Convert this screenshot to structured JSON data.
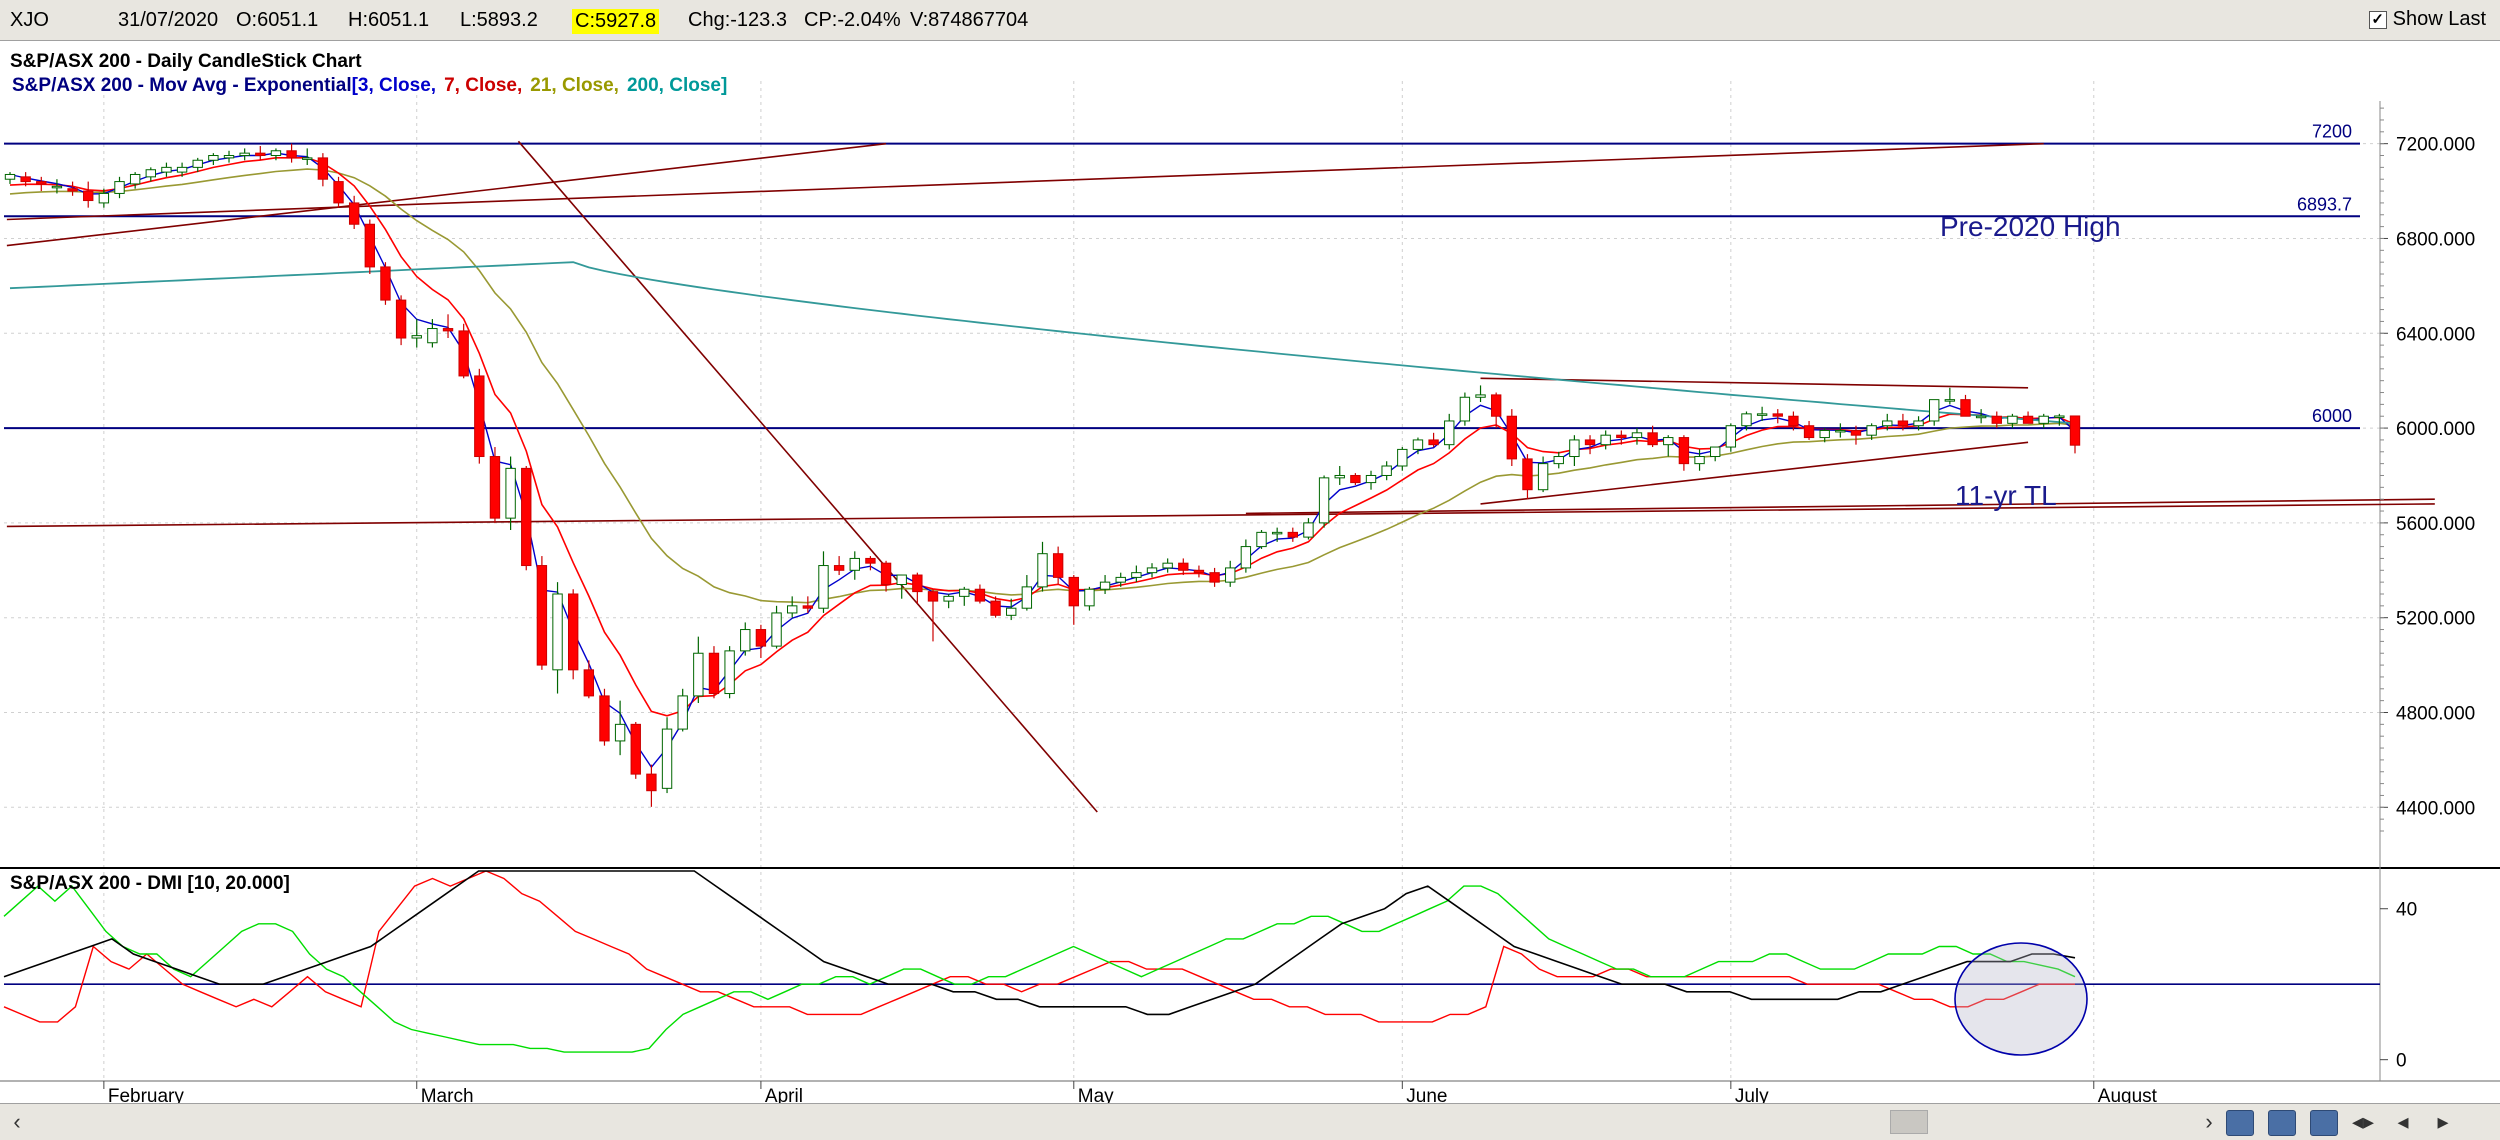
{
  "infobar": {
    "symbol": "XJO",
    "date": "31/07/2020",
    "open": "O:6051.1",
    "high": "H:6051.1",
    "low": "L:5893.2",
    "close": "C:5927.8",
    "change": "Chg:-123.3",
    "change_pct": "CP:-2.04%",
    "volume": "V:874867704",
    "show_last_label": "Show Last",
    "show_last_checked": true
  },
  "main_panel": {
    "title": "S&P/ASX 200 - Daily CandleStick Chart",
    "mov_avg_label": "S&P/ASX 200 - Mov Avg - Exponential",
    "mov_avg_params": [
      {
        "text": "[3, Close,",
        "color": "#0000cc"
      },
      {
        "text": "7, Close,",
        "color": "#cc0000"
      },
      {
        "text": "21, Close,",
        "color": "#999900"
      },
      {
        "text": "200, Close]",
        "color": "#009999"
      }
    ],
    "y_ticks": [
      "7200.000",
      "6800.000",
      "6400.000",
      "6000.000",
      "5600.000",
      "5200.000",
      "4800.000",
      "4400.000"
    ],
    "ylim": [
      4300,
      7380
    ],
    "level_labels": [
      "7200",
      "6893.7",
      "6000"
    ],
    "annotations": [
      "Pre-2020 High",
      "11-yr TL"
    ]
  },
  "dmi_panel": {
    "title": "S&P/ASX 200 - DMI [10, 20.000]",
    "y_ticks": [
      "40",
      "0"
    ],
    "ylim": [
      -3,
      50
    ]
  },
  "x_axis": {
    "months": [
      "February",
      "March",
      "April",
      "May",
      "June",
      "July",
      "August"
    ]
  },
  "colors": {
    "up_candle": "#ffffff",
    "down_candle": "#ff0000",
    "candle_outline": "#006600",
    "ema3": "#0000cc",
    "ema7": "#ff0000",
    "ema21": "#999933",
    "ema200": "#339999",
    "level_line": "#000080",
    "trendline": "#800000",
    "di_plus": "#00dd00",
    "di_minus": "#ff0000",
    "adx": "#000000"
  },
  "chart_data": {
    "type": "candlestick",
    "dates": [
      "2020-01-23",
      "2020-01-24",
      "2020-01-28",
      "2020-01-29",
      "2020-01-30",
      "2020-01-31",
      "2020-02-03",
      "2020-02-04",
      "2020-02-05",
      "2020-02-06",
      "2020-02-07",
      "2020-02-10",
      "2020-02-11",
      "2020-02-12",
      "2020-02-13",
      "2020-02-14",
      "2020-02-17",
      "2020-02-18",
      "2020-02-19",
      "2020-02-20",
      "2020-02-21",
      "2020-02-24",
      "2020-02-25",
      "2020-02-26",
      "2020-02-27",
      "2020-02-28",
      "2020-03-02",
      "2020-03-03",
      "2020-03-04",
      "2020-03-05",
      "2020-03-06",
      "2020-03-09",
      "2020-03-10",
      "2020-03-11",
      "2020-03-12",
      "2020-03-13",
      "2020-03-16",
      "2020-03-17",
      "2020-03-18",
      "2020-03-19",
      "2020-03-20",
      "2020-03-23",
      "2020-03-24",
      "2020-03-25",
      "2020-03-26",
      "2020-03-27",
      "2020-03-30",
      "2020-03-31",
      "2020-04-01",
      "2020-04-02",
      "2020-04-03",
      "2020-04-06",
      "2020-04-07",
      "2020-04-08",
      "2020-04-09",
      "2020-04-14",
      "2020-04-15",
      "2020-04-16",
      "2020-04-17",
      "2020-04-20",
      "2020-04-21",
      "2020-04-22",
      "2020-04-23",
      "2020-04-24",
      "2020-04-27",
      "2020-04-28",
      "2020-04-29",
      "2020-04-30",
      "2020-05-01",
      "2020-05-04",
      "2020-05-05",
      "2020-05-06",
      "2020-05-07",
      "2020-05-08",
      "2020-05-11",
      "2020-05-12",
      "2020-05-13",
      "2020-05-14",
      "2020-05-15",
      "2020-05-18",
      "2020-05-19",
      "2020-05-20",
      "2020-05-21",
      "2020-05-22",
      "2020-05-25",
      "2020-05-26",
      "2020-05-27",
      "2020-05-28",
      "2020-05-29",
      "2020-06-01",
      "2020-06-02",
      "2020-06-03",
      "2020-06-04",
      "2020-06-05",
      "2020-06-09",
      "2020-06-10",
      "2020-06-11",
      "2020-06-12",
      "2020-06-15",
      "2020-06-16",
      "2020-06-17",
      "2020-06-18",
      "2020-06-19",
      "2020-06-22",
      "2020-06-23",
      "2020-06-24",
      "2020-06-25",
      "2020-06-26",
      "2020-06-29",
      "2020-06-30",
      "2020-07-01",
      "2020-07-02",
      "2020-07-03",
      "2020-07-06",
      "2020-07-07",
      "2020-07-08",
      "2020-07-09",
      "2020-07-10",
      "2020-07-13",
      "2020-07-14",
      "2020-07-15",
      "2020-07-16",
      "2020-07-17",
      "2020-07-20",
      "2020-07-21",
      "2020-07-22",
      "2020-07-23",
      "2020-07-24",
      "2020-07-27",
      "2020-07-28",
      "2020-07-29",
      "2020-07-30",
      "2020-07-31"
    ],
    "open": [
      7050,
      7060,
      7040,
      7020,
      7010,
      7000,
      6950,
      6990,
      7030,
      7060,
      7080,
      7080,
      7100,
      7130,
      7140,
      7150,
      7160,
      7150,
      7170,
      7140,
      7140,
      7040,
      6950,
      6860,
      6680,
      6540,
      6380,
      6360,
      6420,
      6410,
      6220,
      5880,
      5620,
      5830,
      5420,
      4980,
      5300,
      4980,
      4870,
      4680,
      4750,
      4540,
      4480,
      4730,
      4870,
      5050,
      4880,
      5060,
      5150,
      5080,
      5220,
      5250,
      5240,
      5420,
      5400,
      5450,
      5430,
      5340,
      5380,
      5310,
      5270,
      5290,
      5320,
      5270,
      5210,
      5240,
      5330,
      5470,
      5370,
      5250,
      5320,
      5350,
      5370,
      5390,
      5410,
      5430,
      5400,
      5390,
      5350,
      5410,
      5500,
      5560,
      5560,
      5540,
      5600,
      5790,
      5800,
      5770,
      5800,
      5840,
      5910,
      5950,
      5930,
      6030,
      6130,
      6140,
      6050,
      5870,
      5740,
      5850,
      5880,
      5950,
      5930,
      5970,
      5960,
      5980,
      5930,
      5960,
      5850,
      5880,
      5920,
      6010,
      6060,
      6060,
      6050,
      6010,
      5960,
      5990,
      5990,
      5970,
      6010,
      6030,
      6010,
      6030,
      6120,
      6120,
      6050,
      6050,
      6020,
      6050,
      6020,
      6050,
      6051.1
    ],
    "high": [
      7080,
      7080,
      7060,
      7050,
      7040,
      7040,
      7010,
      7060,
      7080,
      7100,
      7120,
      7120,
      7140,
      7160,
      7170,
      7180,
      7190,
      7180,
      7200,
      7180,
      7160,
      7060,
      6980,
      6880,
      6700,
      6560,
      6460,
      6460,
      6480,
      6440,
      6250,
      5920,
      5880,
      5840,
      5460,
      5350,
      5320,
      5020,
      4900,
      4850,
      4760,
      4580,
      4780,
      4900,
      5120,
      5080,
      5080,
      5180,
      5170,
      5250,
      5290,
      5290,
      5480,
      5460,
      5480,
      5460,
      5440,
      5360,
      5390,
      5320,
      5300,
      5330,
      5340,
      5290,
      5280,
      5380,
      5520,
      5500,
      5380,
      5330,
      5380,
      5390,
      5420,
      5430,
      5450,
      5450,
      5420,
      5410,
      5440,
      5530,
      5570,
      5580,
      5580,
      5620,
      5800,
      5840,
      5810,
      5820,
      5860,
      5920,
      5960,
      5980,
      6060,
      6150,
      6180,
      6150,
      6080,
      5890,
      5880,
      5900,
      5970,
      5970,
      5990,
      5990,
      6000,
      6010,
      5970,
      5970,
      5910,
      5920,
      6020,
      6070,
      6090,
      6080,
      6070,
      6030,
      6000,
      6020,
      6010,
      6020,
      6060,
      6060,
      6050,
      6120,
      6170,
      6140,
      6080,
      6070,
      6060,
      6070,
      6060,
      6060,
      6051.1
    ],
    "low": [
      7030,
      7020,
      7000,
      6990,
      6980,
      6930,
      6930,
      6970,
      7010,
      7040,
      7060,
      7060,
      7080,
      7110,
      7120,
      7130,
      7130,
      7130,
      7120,
      7110,
      7020,
      6930,
      6840,
      6650,
      6520,
      6350,
      6340,
      6340,
      6380,
      6210,
      5850,
      5600,
      5570,
      5400,
      4980,
      4880,
      4940,
      4860,
      4660,
      4620,
      4520,
      4402,
      4460,
      4720,
      4840,
      4860,
      4860,
      5040,
      5030,
      5070,
      5200,
      5220,
      5220,
      5380,
      5360,
      5400,
      5310,
      5280,
      5260,
      5100,
      5240,
      5250,
      5260,
      5200,
      5190,
      5230,
      5310,
      5340,
      5170,
      5230,
      5300,
      5330,
      5350,
      5370,
      5390,
      5380,
      5370,
      5330,
      5330,
      5390,
      5490,
      5520,
      5520,
      5530,
      5580,
      5760,
      5760,
      5740,
      5780,
      5820,
      5890,
      5920,
      5910,
      6010,
      6110,
      6000,
      5840,
      5700,
      5730,
      5830,
      5840,
      5890,
      5910,
      5930,
      5930,
      5920,
      5880,
      5820,
      5820,
      5860,
      5900,
      5990,
      6030,
      6020,
      5990,
      5950,
      5940,
      5960,
      5930,
      5950,
      5990,
      5990,
      5990,
      6010,
      6100,
      6050,
      6020,
      6000,
      6000,
      6020,
      6000,
      6010,
      5893.2
    ],
    "close": [
      7070,
      7040,
      7030,
      7020,
      7000,
      6960,
      6990,
      7040,
      7070,
      7090,
      7100,
      7100,
      7130,
      7150,
      7150,
      7160,
      7150,
      7170,
      7140,
      7140,
      7050,
      6950,
      6860,
      6680,
      6540,
      6380,
      6390,
      6420,
      6410,
      6220,
      5880,
      5620,
      5830,
      5420,
      5000,
      5300,
      4980,
      4870,
      4680,
      4750,
      4540,
      4470,
      4730,
      4870,
      5050,
      4880,
      5060,
      5150,
      5080,
      5220,
      5250,
      5240,
      5420,
      5400,
      5450,
      5430,
      5340,
      5380,
      5310,
      5270,
      5290,
      5320,
      5270,
      5210,
      5240,
      5330,
      5470,
      5370,
      5250,
      5320,
      5350,
      5370,
      5390,
      5410,
      5430,
      5400,
      5390,
      5350,
      5410,
      5500,
      5560,
      5560,
      5540,
      5600,
      5790,
      5800,
      5770,
      5800,
      5840,
      5910,
      5950,
      5930,
      6030,
      6130,
      6140,
      6050,
      5870,
      5740,
      5850,
      5880,
      5950,
      5930,
      5970,
      5960,
      5980,
      5930,
      5960,
      5850,
      5880,
      5920,
      6010,
      6060,
      6060,
      6050,
      6010,
      5960,
      5990,
      5990,
      5970,
      6010,
      6030,
      6010,
      6030,
      6120,
      6120,
      6050,
      6050,
      6020,
      6050,
      6020,
      6050,
      6051.1,
      5927.8
    ],
    "ema200_approx": {
      "start": 6590,
      "peak": 6700,
      "end": 6020
    },
    "dmi": {
      "di_plus": [
        38,
        42,
        46,
        42,
        46,
        40,
        34,
        30,
        28,
        28,
        24,
        22,
        26,
        30,
        34,
        36,
        36,
        34,
        28,
        24,
        22,
        18,
        14,
        10,
        8,
        7,
        6,
        5,
        4,
        4,
        4,
        3,
        3,
        2,
        2,
        2,
        2,
        2,
        3,
        8,
        12,
        14,
        16,
        18,
        18,
        16,
        18,
        20,
        20,
        22,
        22,
        20,
        22,
        24,
        24,
        22,
        20,
        20,
        22,
        22,
        24,
        26,
        28,
        30,
        28,
        26,
        24,
        22,
        24,
        26,
        28,
        30,
        32,
        32,
        34,
        36,
        36,
        38,
        38,
        36,
        34,
        34,
        36,
        38,
        40,
        42,
        46,
        46,
        44,
        40,
        36,
        32,
        30,
        28,
        26,
        24,
        24,
        22,
        22,
        22,
        24,
        26,
        26,
        26,
        28,
        28,
        26,
        24,
        24,
        24,
        26,
        28,
        28,
        28,
        30,
        30,
        28,
        28,
        26,
        26,
        25,
        24,
        22
      ],
      "di_minus": [
        14,
        12,
        10,
        10,
        14,
        30,
        26,
        24,
        28,
        24,
        20,
        18,
        16,
        14,
        16,
        14,
        18,
        22,
        18,
        16,
        14,
        34,
        40,
        46,
        48,
        46,
        48,
        50,
        48,
        44,
        42,
        38,
        34,
        32,
        30,
        28,
        24,
        22,
        20,
        18,
        18,
        16,
        14,
        14,
        14,
        12,
        12,
        12,
        12,
        14,
        16,
        18,
        20,
        22,
        22,
        20,
        20,
        18,
        20,
        20,
        22,
        24,
        26,
        26,
        24,
        24,
        24,
        22,
        20,
        18,
        16,
        16,
        14,
        14,
        12,
        12,
        12,
        10,
        10,
        10,
        10,
        12,
        12,
        14,
        30,
        28,
        24,
        22,
        22,
        22,
        24,
        24,
        22,
        22,
        22,
        22,
        22,
        22,
        22,
        22,
        22,
        20,
        20,
        20,
        20,
        20,
        18,
        16,
        16,
        14,
        14,
        16,
        16,
        18,
        20,
        20,
        20
      ],
      "adx": [
        22,
        24,
        26,
        28,
        30,
        32,
        28,
        26,
        24,
        22,
        20,
        20,
        20,
        22,
        24,
        26,
        28,
        30,
        34,
        38,
        42,
        46,
        50,
        52,
        54,
        56,
        58,
        60,
        60,
        58,
        56,
        54,
        50,
        46,
        42,
        38,
        34,
        30,
        26,
        24,
        22,
        20,
        20,
        20,
        18,
        18,
        16,
        16,
        14,
        14,
        14,
        14,
        14,
        12,
        12,
        14,
        16,
        18,
        20,
        24,
        28,
        32,
        36,
        38,
        40,
        44,
        46,
        42,
        38,
        34,
        30,
        28,
        26,
        24,
        22,
        20,
        20,
        20,
        18,
        18,
        18,
        16,
        16,
        16,
        16,
        16,
        18,
        18,
        20,
        22,
        24,
        26,
        26,
        26,
        28,
        28,
        27
      ],
      "threshold": 20,
      "ylim": [
        -3,
        50
      ]
    },
    "horizontal_levels": [
      7200,
      6893.7,
      6000
    ],
    "xlabel": "",
    "ylabel": ""
  }
}
